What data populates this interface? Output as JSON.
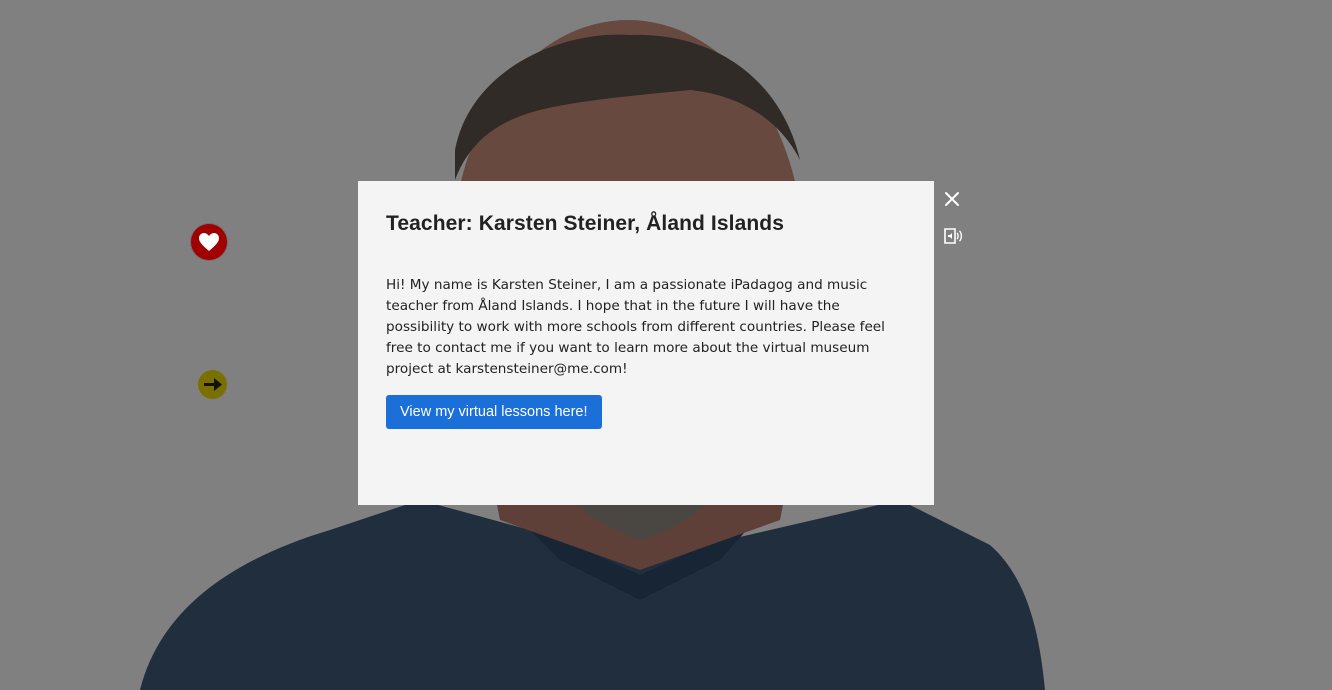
{
  "modal": {
    "title": "Teacher: Karsten Steiner, Åland Islands",
    "body": "Hi! My name is Karsten Steiner, I am a passionate iPadagog and music teacher from Åland Islands. I hope that in the future I will have the possibility to work with more schools from different countries. Please feel free to contact me if you want to learn more about the virtual museum project at karstensteiner@me.com!",
    "button_label": "View my virtual lessons here!"
  },
  "controls": {
    "close_icon": "close-icon",
    "audio_icon": "audio-description-icon"
  },
  "hotspots": [
    {
      "icon": "heart-icon",
      "color": "#a10000"
    },
    {
      "icon": "arrow-right-icon",
      "color": "#7a7000"
    }
  ],
  "colors": {
    "accent": "#1a6fd8",
    "overlay": "rgba(0,0,0,0.47)"
  }
}
